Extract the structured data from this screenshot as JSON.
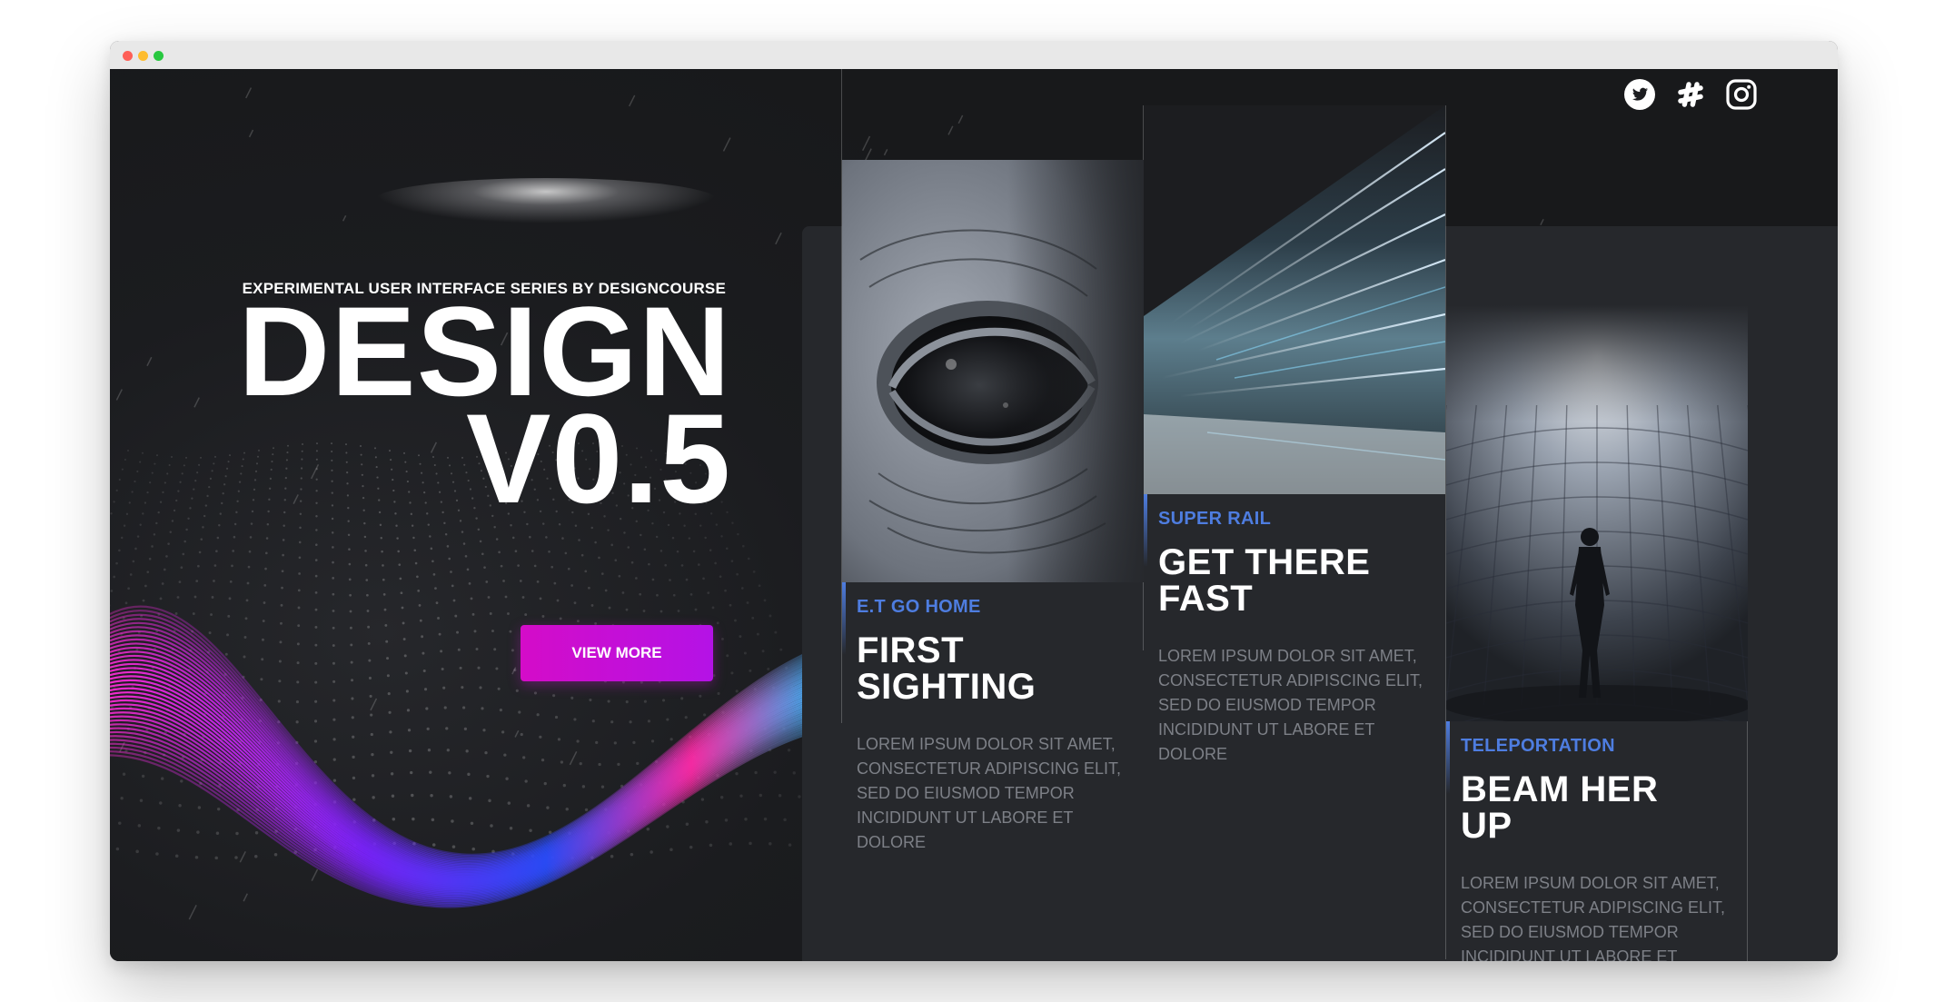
{
  "hero": {
    "subtitle": "EXPERIMENTAL USER INTERFACE SERIES BY DESIGNCOURSE",
    "title_line1": "DESIGN",
    "title_line2": "V0.5",
    "button_label": "VIEW MORE"
  },
  "social": {
    "icons": [
      "twitter-icon",
      "slack-icon",
      "instagram-icon"
    ]
  },
  "cards": [
    {
      "eyebrow": "E.T GO HOME",
      "title_line1": "FIRST",
      "title_line2": "SIGHTING",
      "body": "LOREM IPSUM DOLOR SIT AMET, CONSECTETUR ADIPISCING ELIT, SED DO EIUSMOD TEMPOR INCIDIDUNT UT LABORE ET DOLORE"
    },
    {
      "eyebrow": "SUPER RAIL",
      "title_line1": "GET THERE",
      "title_line2": "FAST",
      "body": "LOREM IPSUM DOLOR SIT AMET, CONSECTETUR ADIPISCING ELIT, SED DO EIUSMOD TEMPOR INCIDIDUNT UT LABORE ET DOLORE"
    },
    {
      "eyebrow": "TELEPORTATION",
      "title_line1": "BEAM HER",
      "title_line2": "UP",
      "body": "LOREM IPSUM DOLOR SIT AMET, CONSECTETUR ADIPISCING ELIT, SED DO EIUSMOD TEMPOR INCIDIDUNT UT LABORE ET DOLORE"
    }
  ],
  "colors": {
    "accent_blue": "#4e7de0",
    "button_gradient_start": "#d40cc8",
    "button_gradient_end": "#b412e6",
    "background": "#1c1d20",
    "panel": "#26282c"
  }
}
